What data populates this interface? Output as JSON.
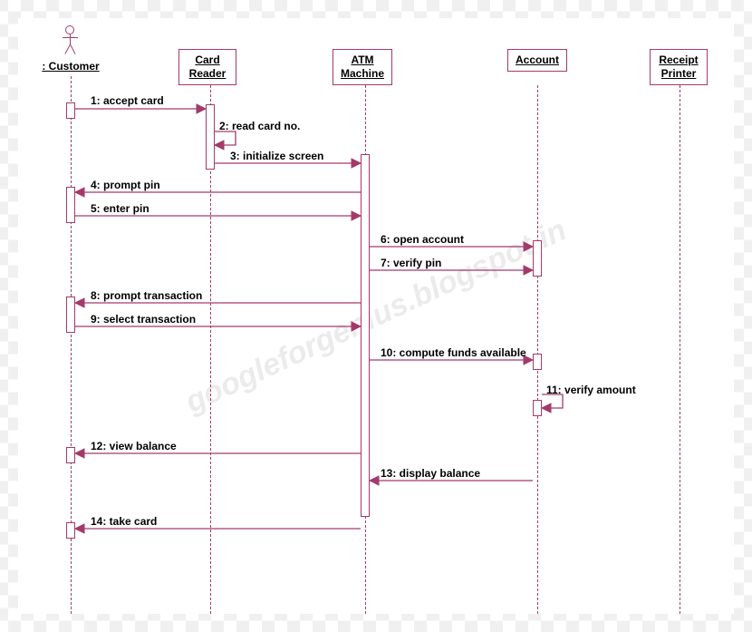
{
  "watermark": "googleforgenius.blogspot.in",
  "participants": {
    "customer": ": Customer",
    "card_reader": "Card\nReader",
    "atm_machine": "ATM\nMachine",
    "account": "Account",
    "receipt_printer": "Receipt\nPrinter"
  },
  "messages": {
    "m1": "1: accept card",
    "m2": "2: read card no.",
    "m3": "3: initialize screen",
    "m4": "4: prompt pin",
    "m5": "5: enter pin",
    "m6": "6: open account",
    "m7": "7: verify pin",
    "m8": "8: prompt transaction",
    "m9": "9: select transaction",
    "m10": "10: compute funds available",
    "m11": "11: verify amount",
    "m12": "12: view balance",
    "m13": "13: display balance",
    "m14": "14: take card"
  }
}
